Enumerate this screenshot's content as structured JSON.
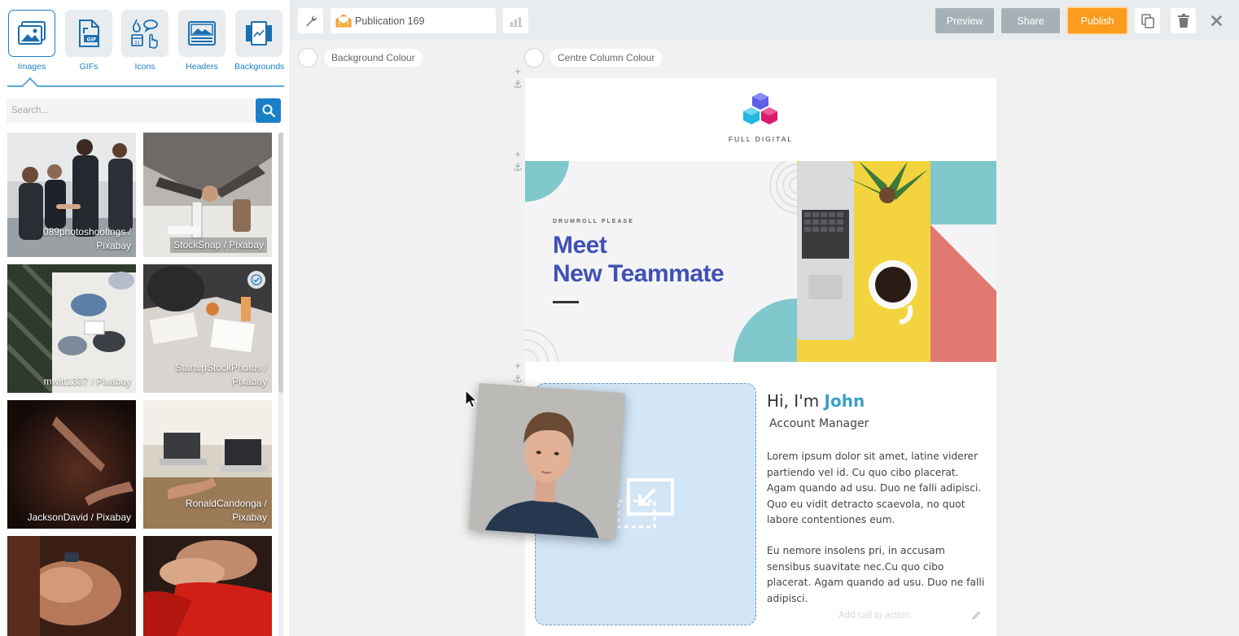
{
  "sidebar": {
    "tabs": [
      {
        "label": "Images",
        "icon": "images-icon"
      },
      {
        "label": "GIFs",
        "icon": "gif-icon"
      },
      {
        "label": "Icons",
        "icon": "icons-icon"
      },
      {
        "label": "Headers",
        "icon": "headers-icon"
      },
      {
        "label": "Backgrounds",
        "icon": "backgrounds-icon"
      }
    ],
    "search_placeholder": "Search...",
    "images": [
      {
        "credit": "089photoshootings / Pixabay"
      },
      {
        "credit": "StockSnap / Pixabay"
      },
      {
        "credit": "mwitt1337 / Pixabay"
      },
      {
        "credit": "StartupStockPhotos / Pixabay"
      },
      {
        "credit": "JacksonDavid / Pixabay"
      },
      {
        "credit": "RonaldCandonga / Pixabay"
      },
      {
        "credit": ""
      },
      {
        "credit": ""
      }
    ]
  },
  "toolbar": {
    "publication_name": "Publication 169",
    "preview_label": "Preview",
    "share_label": "Share",
    "publish_label": "Publish"
  },
  "canvas": {
    "background_colour_label": "Background Colour",
    "centre_column_colour_label": "Centre Column Colour"
  },
  "email": {
    "logo_text": "FULL DIGITAL",
    "hero": {
      "kicker": "DRUMROLL PLEASE",
      "title_line1": "Meet",
      "title_line2": "New Teammate"
    },
    "greeting": "Hi, I'm ",
    "name": "John",
    "role": "Account Manager",
    "paragraph1": "Lorem ipsum dolor sit amet, latine viderer partiendo vel id. Cu quo cibo placerat. Agam quando ad usu. Duo ne falli adipisci. Quo eu vidit detracto scaevola, no quot labore contentiones eum.",
    "paragraph2": "Eu nemore insolens pri, in accusam sensibus suavitate nec.Cu quo cibo placerat. Agam quando ad usu. Duo ne falli adipisci.",
    "cta_placeholder": "Add call to action"
  },
  "colors": {
    "accent_blue": "#1b7fc7",
    "publish_orange": "#fb9c1d",
    "hero_title": "#3f51b5",
    "name_teal": "#3ba0c5"
  }
}
